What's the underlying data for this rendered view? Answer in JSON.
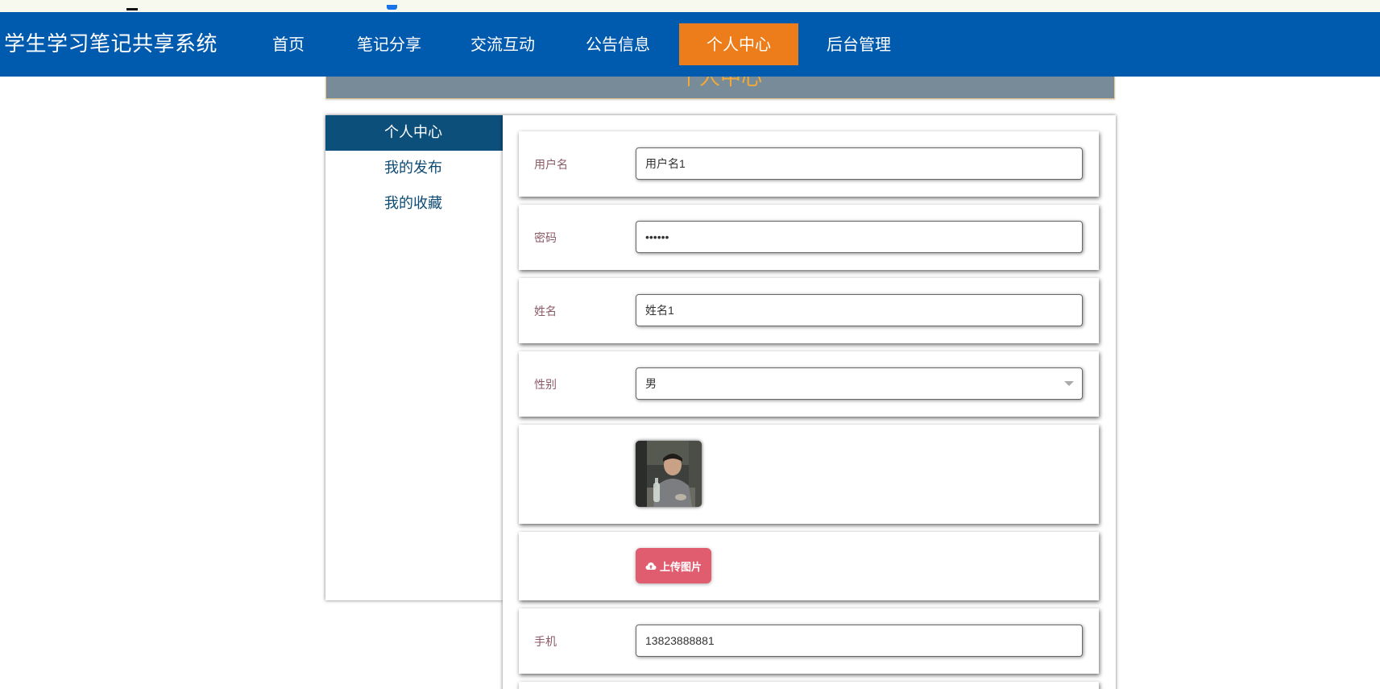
{
  "navbar": {
    "brand": "学生学习笔记共享系统",
    "items": [
      {
        "label": "首页"
      },
      {
        "label": "笔记分享"
      },
      {
        "label": "交流互动"
      },
      {
        "label": "公告信息"
      },
      {
        "label": "个人中心"
      },
      {
        "label": "后台管理"
      }
    ],
    "active_item": "个人中心",
    "accent_color": "#ec7d1a",
    "bar_color": "#005aae"
  },
  "banner": {
    "title": "个人中心"
  },
  "sidebar": {
    "items": [
      {
        "label": "个人中心"
      },
      {
        "label": "我的发布"
      },
      {
        "label": "我的收藏"
      }
    ],
    "active_item": "个人中心"
  },
  "form": {
    "username": {
      "label": "用户名",
      "value": "用户名1"
    },
    "password": {
      "label": "密码",
      "value": "••••••"
    },
    "name": {
      "label": "姓名",
      "value": "姓名1"
    },
    "gender": {
      "label": "性别",
      "value": "男"
    },
    "upload": {
      "label": "上传图片",
      "icon": "cloud-upload-icon",
      "color": "#e05d6f"
    },
    "phone": {
      "label": "手机",
      "value": "13823888881"
    }
  }
}
